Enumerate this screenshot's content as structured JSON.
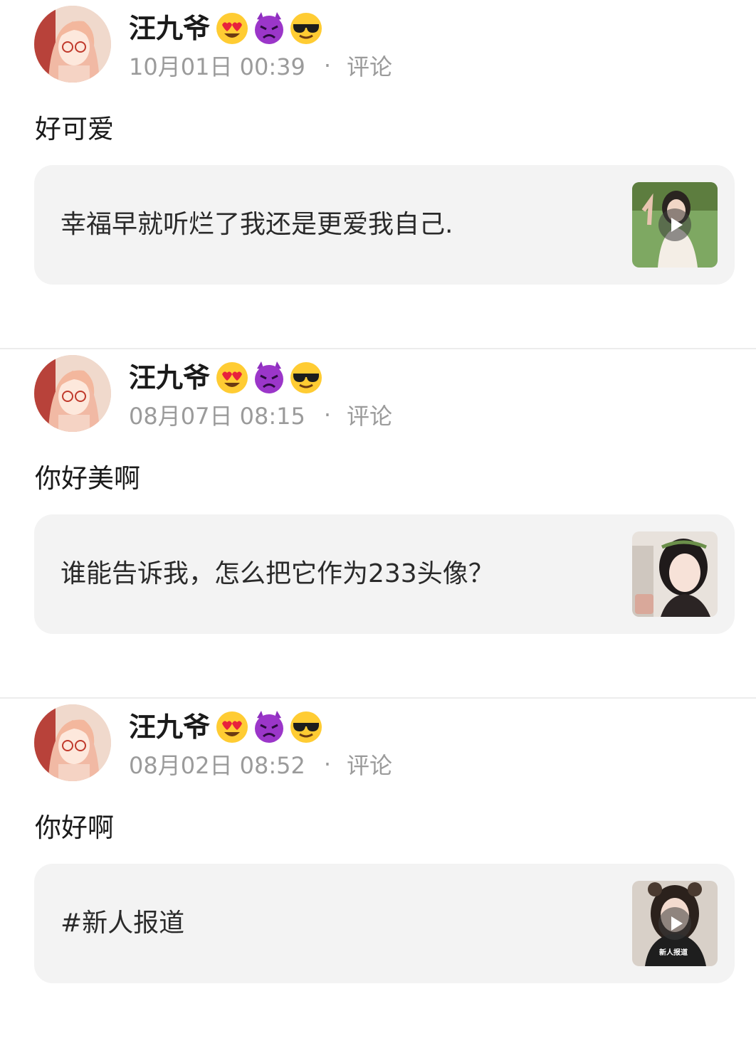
{
  "posts": [
    {
      "username": "汪九爷",
      "emojis": [
        "heart-eyes-emoji",
        "angry-devil-emoji",
        "sunglasses-emoji"
      ],
      "timestamp": "10月01日 00:39",
      "separator": "·",
      "comment_label": "评论",
      "text": "好可爱",
      "quote_text": "幸福早就听烂了我还是更爱我自己.",
      "thumbnail_type": "video"
    },
    {
      "username": "汪九爷",
      "emojis": [
        "heart-eyes-emoji",
        "angry-devil-emoji",
        "sunglasses-emoji"
      ],
      "timestamp": "08月07日 08:15",
      "separator": "·",
      "comment_label": "评论",
      "text": "你好美啊",
      "quote_text": "谁能告诉我，怎么把它作为233头像？",
      "thumbnail_type": "image"
    },
    {
      "username": "汪九爷",
      "emojis": [
        "heart-eyes-emoji",
        "angry-devil-emoji",
        "sunglasses-emoji"
      ],
      "timestamp": "08月02日 08:52",
      "separator": "·",
      "comment_label": "评论",
      "text": "你好啊",
      "quote_text": "#新人报道",
      "thumbnail_type": "video",
      "thumbnail_caption": "新人报道"
    }
  ]
}
